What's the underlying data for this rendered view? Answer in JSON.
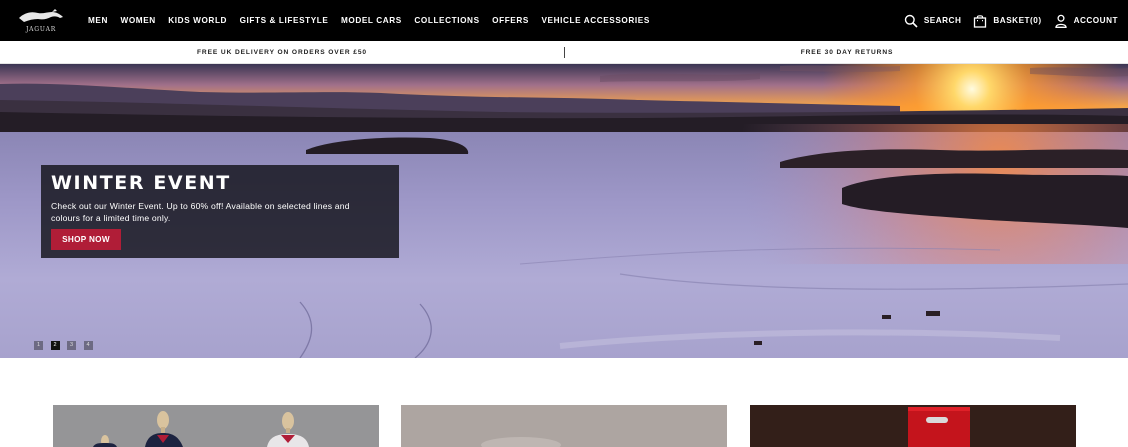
{
  "brand": {
    "logo_text": "JAGUAR"
  },
  "nav": {
    "items": [
      "MEN",
      "WOMEN",
      "KIDS WORLD",
      "GIFTS & LIFESTYLE",
      "MODEL CARS",
      "COLLECTIONS",
      "OFFERS",
      "VEHICLE ACCESSORIES"
    ]
  },
  "utility": {
    "search_label": "SEARCH",
    "basket_label": "BASKET(0)",
    "account_label": "ACCOUNT"
  },
  "promo": {
    "left": "FREE UK DELIVERY ON ORDERS OVER £50",
    "right": "FREE 30 DAY RETURNS"
  },
  "hero": {
    "title": "WINTER EVENT",
    "text": "Check out our Winter Event. Up to 60% off! Available on selected lines and colours for a limited time only.",
    "cta": "SHOP NOW",
    "slides": [
      "1",
      "2",
      "3",
      "4"
    ],
    "active_slide": 2
  },
  "colors": {
    "nav_bg": "#000000",
    "cta": "#b01d37"
  }
}
